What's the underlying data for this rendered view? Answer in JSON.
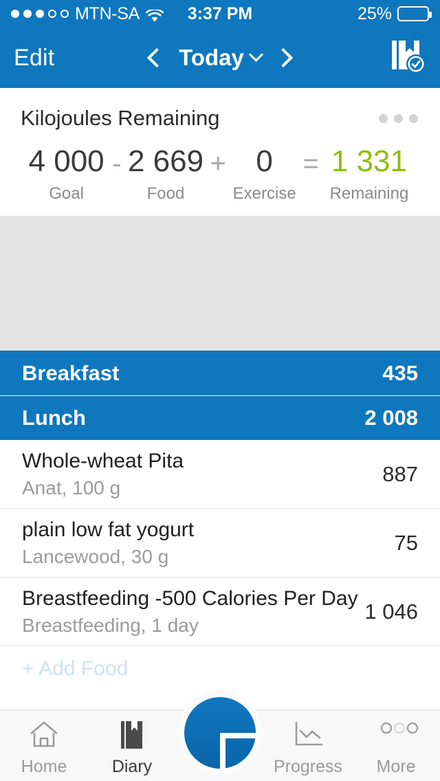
{
  "status_bar": {
    "signal_dots_filled": 3,
    "signal_dots_total": 5,
    "carrier": "MTN-SA",
    "wifi_icon": "wifi-icon",
    "time": "3:37 PM",
    "battery_percent": "25%",
    "battery_level": 25,
    "battery_color": "#FDC600"
  },
  "nav": {
    "edit_label": "Edit",
    "prev_icon": "chevron-left-icon",
    "title": "Today",
    "title_dropdown_icon": "chevron-down-icon",
    "next_icon": "chevron-right-icon",
    "diary_complete_icon": "diary-check-icon"
  },
  "summary": {
    "title": "Kilojoules Remaining",
    "menu_icon": "kebab-menu-icon",
    "goal": {
      "value": "4 000",
      "label": "Goal"
    },
    "op1": "-",
    "food": {
      "value": "2 669",
      "label": "Food"
    },
    "op2": "+",
    "exercise": {
      "value": "0",
      "label": "Exercise"
    },
    "op3": "=",
    "remaining": {
      "value": "1 331",
      "label": "Remaining",
      "color": "#8CC00B"
    }
  },
  "meals": [
    {
      "name": "Breakfast",
      "total": "435"
    },
    {
      "name": "Lunch",
      "total": "2 008"
    }
  ],
  "entries": [
    {
      "name": "Whole-wheat Pita",
      "detail": "Anat, 100 g",
      "value": "887"
    },
    {
      "name": "plain low fat yogurt",
      "detail": "Lancewood, 30 g",
      "value": "75"
    },
    {
      "name": "Breastfeeding -500 Calories Per Day",
      "detail": "Breastfeeding, 1 day",
      "value": "1 046"
    }
  ],
  "add_food_label": "+ Add Food",
  "tabs": [
    {
      "label": "Home",
      "icon": "home-icon",
      "active": false
    },
    {
      "label": "Diary",
      "icon": "diary-book-icon",
      "active": true
    },
    {
      "label": "Progress",
      "icon": "line-chart-icon",
      "active": false
    },
    {
      "label": "More",
      "icon": "more-circles-icon",
      "active": false
    }
  ],
  "fab": {
    "icon": "plus-icon",
    "label": "Add",
    "color": "#0E77BD"
  },
  "theme": {
    "primary_blue": "#0E77BD",
    "green": "#8CC00B",
    "placeholder_gray": "#e3e3e3"
  }
}
